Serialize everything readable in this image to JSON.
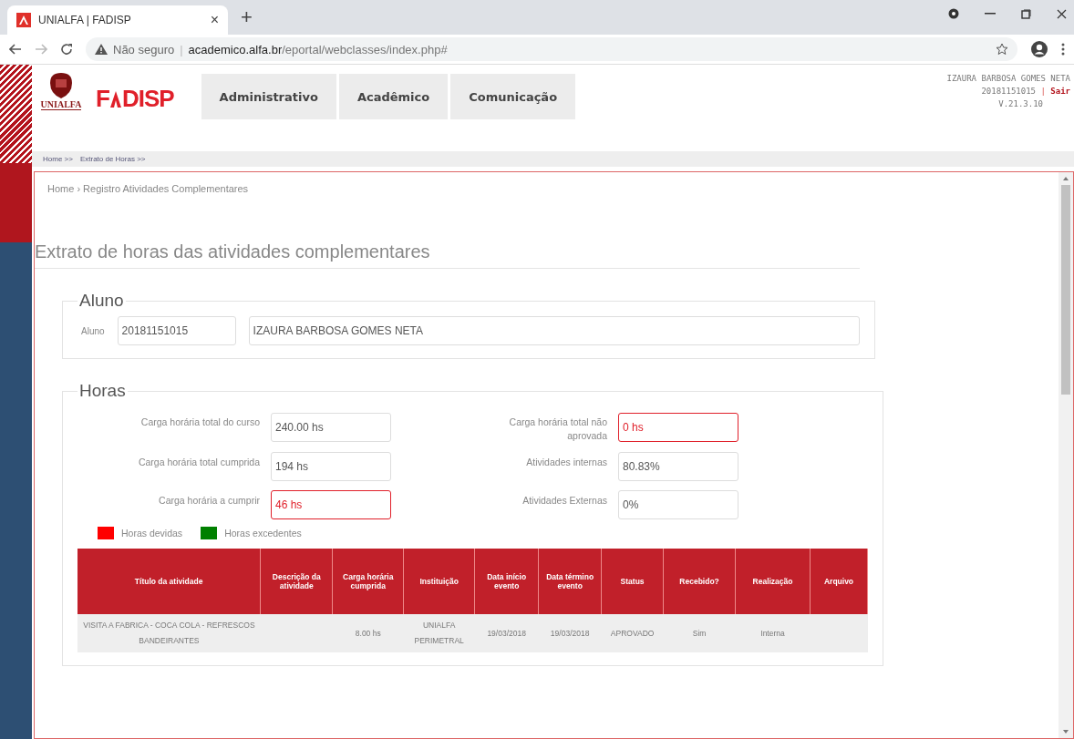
{
  "browser": {
    "tab_title": "UNIALFA | FADISP",
    "tab_close": "×",
    "new_tab": "+",
    "security": "Não seguro",
    "security_separator": "|",
    "url_host": "academico.alfa.br",
    "url_path": "/eportal/webclasses/index.php#"
  },
  "header": {
    "unialfa_logo": "UNIALFA",
    "fadisp_logo": {
      "left": "F",
      "right": "DISP"
    },
    "nav": [
      {
        "label": "Administrativo"
      },
      {
        "label": "Acadêmico"
      },
      {
        "label": "Comunicação"
      }
    ],
    "user": {
      "name": "IZAURA BARBOSA GOMES NETA",
      "matricula": "20181151015",
      "separator": "|",
      "logout": "Sair",
      "version": "V.21.3.10"
    }
  },
  "top_breadcrumb": [
    "Home >>",
    "Extrato de Horas >>"
  ],
  "breadcrumb": "Home › Registro Atividades Complementares",
  "title": "Extrato de horas das atividades complementares",
  "aluno": {
    "legend": "Aluno",
    "label": "Aluno",
    "code": "20181151015",
    "name": "IZAURA BARBOSA GOMES NETA"
  },
  "horas": {
    "legend": "Horas",
    "left_fields": [
      {
        "label": "Carga horária total do curso",
        "value": "240.00 hs",
        "alert": false
      },
      {
        "label": "Carga horária total cumprida",
        "value": "194 hs",
        "alert": false
      },
      {
        "label": "Carga horária a cumprir",
        "value": "46 hs",
        "alert": true
      }
    ],
    "right_fields": [
      {
        "label": "Carga horária total não aprovada",
        "value": "0 hs",
        "alert": true
      },
      {
        "label": "Atividades internas",
        "value": "80.83%",
        "alert": false
      },
      {
        "label": "Atividades Externas",
        "value": "0%",
        "alert": false
      }
    ],
    "legend_items": [
      {
        "label": "Horas devidas",
        "color": "#ff0000"
      },
      {
        "label": "Horas excedentes",
        "color": "#008000"
      }
    ]
  },
  "table": {
    "columns": [
      "Título da atividade",
      "Descrição da atividade",
      "Carga horária cumprida",
      "Instituição",
      "Data início evento",
      "Data término evento",
      "Status",
      "Recebido?",
      "Realização",
      "Arquivo"
    ],
    "rows": [
      [
        "VISITA A FABRICA - COCA COLA - REFRESCOS BANDEIRANTES",
        null,
        "8.00 hs",
        "UNIALFA PERIMETRAL",
        "19/03/2018",
        "19/03/2018",
        "APROVADO",
        "Sim",
        "Interna",
        null
      ]
    ]
  }
}
